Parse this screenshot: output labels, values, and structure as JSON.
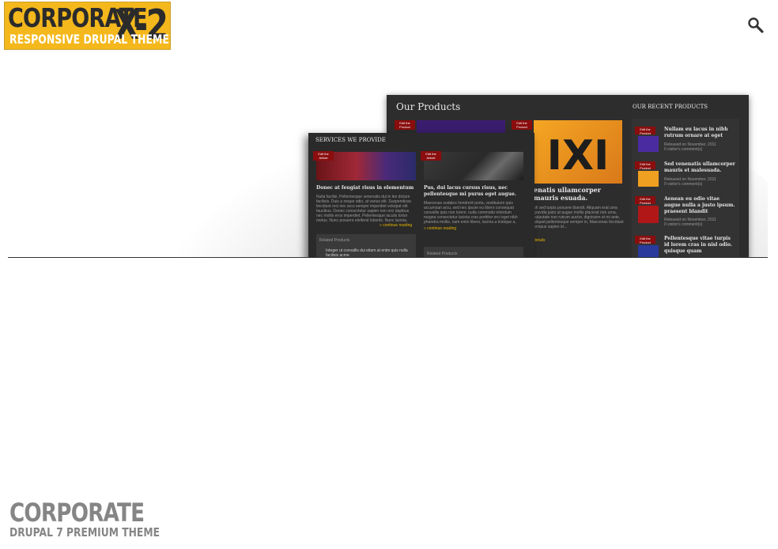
{
  "header": {
    "logo_title": "CORPORATE",
    "logo_mark": "X-2",
    "logo_subtitle": "RESPONSIVE DRUPAL THEME",
    "search_icon": "search-icon"
  },
  "slide": {
    "back_panel": {
      "heading": "Our Products",
      "sidebar_heading": "OUR RECENT PRODUCTS",
      "edit_tag": "Edit the Product",
      "main_title": "enatis ullamcorper mauris esuada.",
      "main_text": "bh sed turpis posuere blandit. Aliquam erat uma gravida justo at augue mollis placerat roin urna, vulputate non rutrum auctor, dignissim et mi ante, aliquet pellentesque semper in, Maecenas tincidunt tempus sapien id...",
      "main_more": "details",
      "recent": [
        {
          "title": "Nullam eu lacus in nibh rutrum ornare at eget tellus.",
          "meta": "Released on November, 2011",
          "comments": "0 visitor's comment(s)"
        },
        {
          "title": "Sed venenatis ullamcorper mauris et malesuada.",
          "meta": "Released on November, 2011",
          "comments": "0 visitor's comment(s)"
        },
        {
          "title": "Aenean eu odio vitae augue nulla a justo ipsum. praesent blandit",
          "meta": "Released on November, 2011",
          "comments": "0 visitor's comment(s)"
        },
        {
          "title": "Pellentesque vitae turpis id lorem cras in nisl odio. quisque quam",
          "meta": "",
          "comments": ""
        }
      ]
    },
    "front_panel": {
      "heading": "SERVICES WE PROVIDE",
      "edit_tag": "Edit the Article",
      "articles": [
        {
          "title": "Donec at feugiat risus in elementum magna",
          "text": "Nulla facilisi. Pellentesque venenatis dui in leo dictum facilisis. Duis a neque odio, at varius elit. Suspendisse tincidunt orci nec arcu semper imperdiet volutpat elit faucibus. Donec consectetur sapien non orci dapibus nec mollis eros imperdiet. Pellentesque iaculis tortor metus. Nunc posuere eleifend lobortis. Nunc lacinia, sem ac laoreet...",
          "more": "» continue reading",
          "related_heading": "Related Products",
          "related_item": "Integer ut convallis dui etiam at enim quis nulla facilisis acme"
        },
        {
          "title": "Pus, dui lacus cursus risus, nec pellentesque mi purus eget augue.",
          "text": "Maecenas sodales hendrerit porta, vestibulum quis accumsan arcu, sed nec ipsum eu libero consequat convallis quis non lorem. nulla commodo interdum magna consectetur lacinia cras porttitor orci eget nibh pharetra mollis, nam enim libero, lacinia a tristique a, accumsan sed purus. pellentesque habitant morbi tristique senectus et netus et...",
          "more": "» continue reading",
          "related_heading": "Related Products"
        }
      ]
    }
  },
  "footer": {
    "logo_title": "CORPORATE",
    "logo_subtitle": "DRUPAL 7 PREMIUM THEME"
  },
  "colors": {
    "logo_bg": "#f4b81c",
    "panel_bg": "#2d2d2d",
    "tag_red": "#8b0d0d",
    "accent_yellow": "#e7b500",
    "footer_gray": "#858585"
  }
}
